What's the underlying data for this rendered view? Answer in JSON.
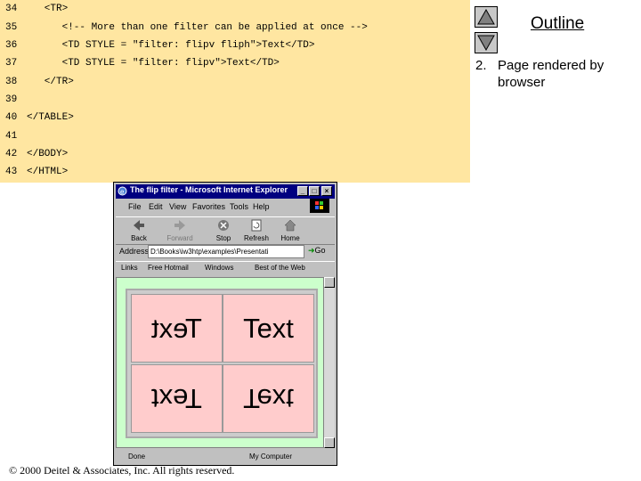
{
  "code": {
    "lines": [
      {
        "num": "34",
        "text": "   <TR>"
      },
      {
        "num": "35",
        "text": "      <!-- More than one filter can be applied at once -->"
      },
      {
        "num": "36",
        "text": "      <TD STYLE = \"filter: flipv fliph\">Text</TD>"
      },
      {
        "num": "37",
        "text": "      <TD STYLE = \"filter: flipv\">Text</TD>"
      },
      {
        "num": "38",
        "text": "   </TR>"
      },
      {
        "num": "39",
        "text": ""
      },
      {
        "num": "40",
        "text": "</TABLE>"
      },
      {
        "num": "41",
        "text": ""
      },
      {
        "num": "42",
        "text": "</BODY>"
      },
      {
        "num": "43",
        "text": "</HTML>"
      }
    ]
  },
  "outline": {
    "title": "Outline",
    "item_number": "2.",
    "item_text": "Page rendered by browser"
  },
  "browser": {
    "title": "The flip filter - Microsoft Internet Explorer",
    "menu": [
      "File",
      "Edit",
      "View",
      "Favorites",
      "Tools",
      "Help"
    ],
    "toolbar": [
      "Back",
      "Forward",
      "Stop",
      "Refresh",
      "Home"
    ],
    "toolbar_icons": [
      "back-arrow-icon",
      "forward-arrow-icon",
      "stop-icon",
      "refresh-icon",
      "home-icon"
    ],
    "address_label": "Address",
    "address_value": "D:\\Books\\iw3htp\\examples\\Presentati",
    "go_label": "Go",
    "links": [
      "Links",
      "Free Hotmail",
      "Windows",
      "Best of the Web"
    ],
    "cells": [
      "Text",
      "Text",
      "Text",
      "Text"
    ],
    "status": "Done",
    "zone": "My Computer"
  },
  "copyright": "© 2000 Deitel & Associates, Inc.  All rights reserved."
}
